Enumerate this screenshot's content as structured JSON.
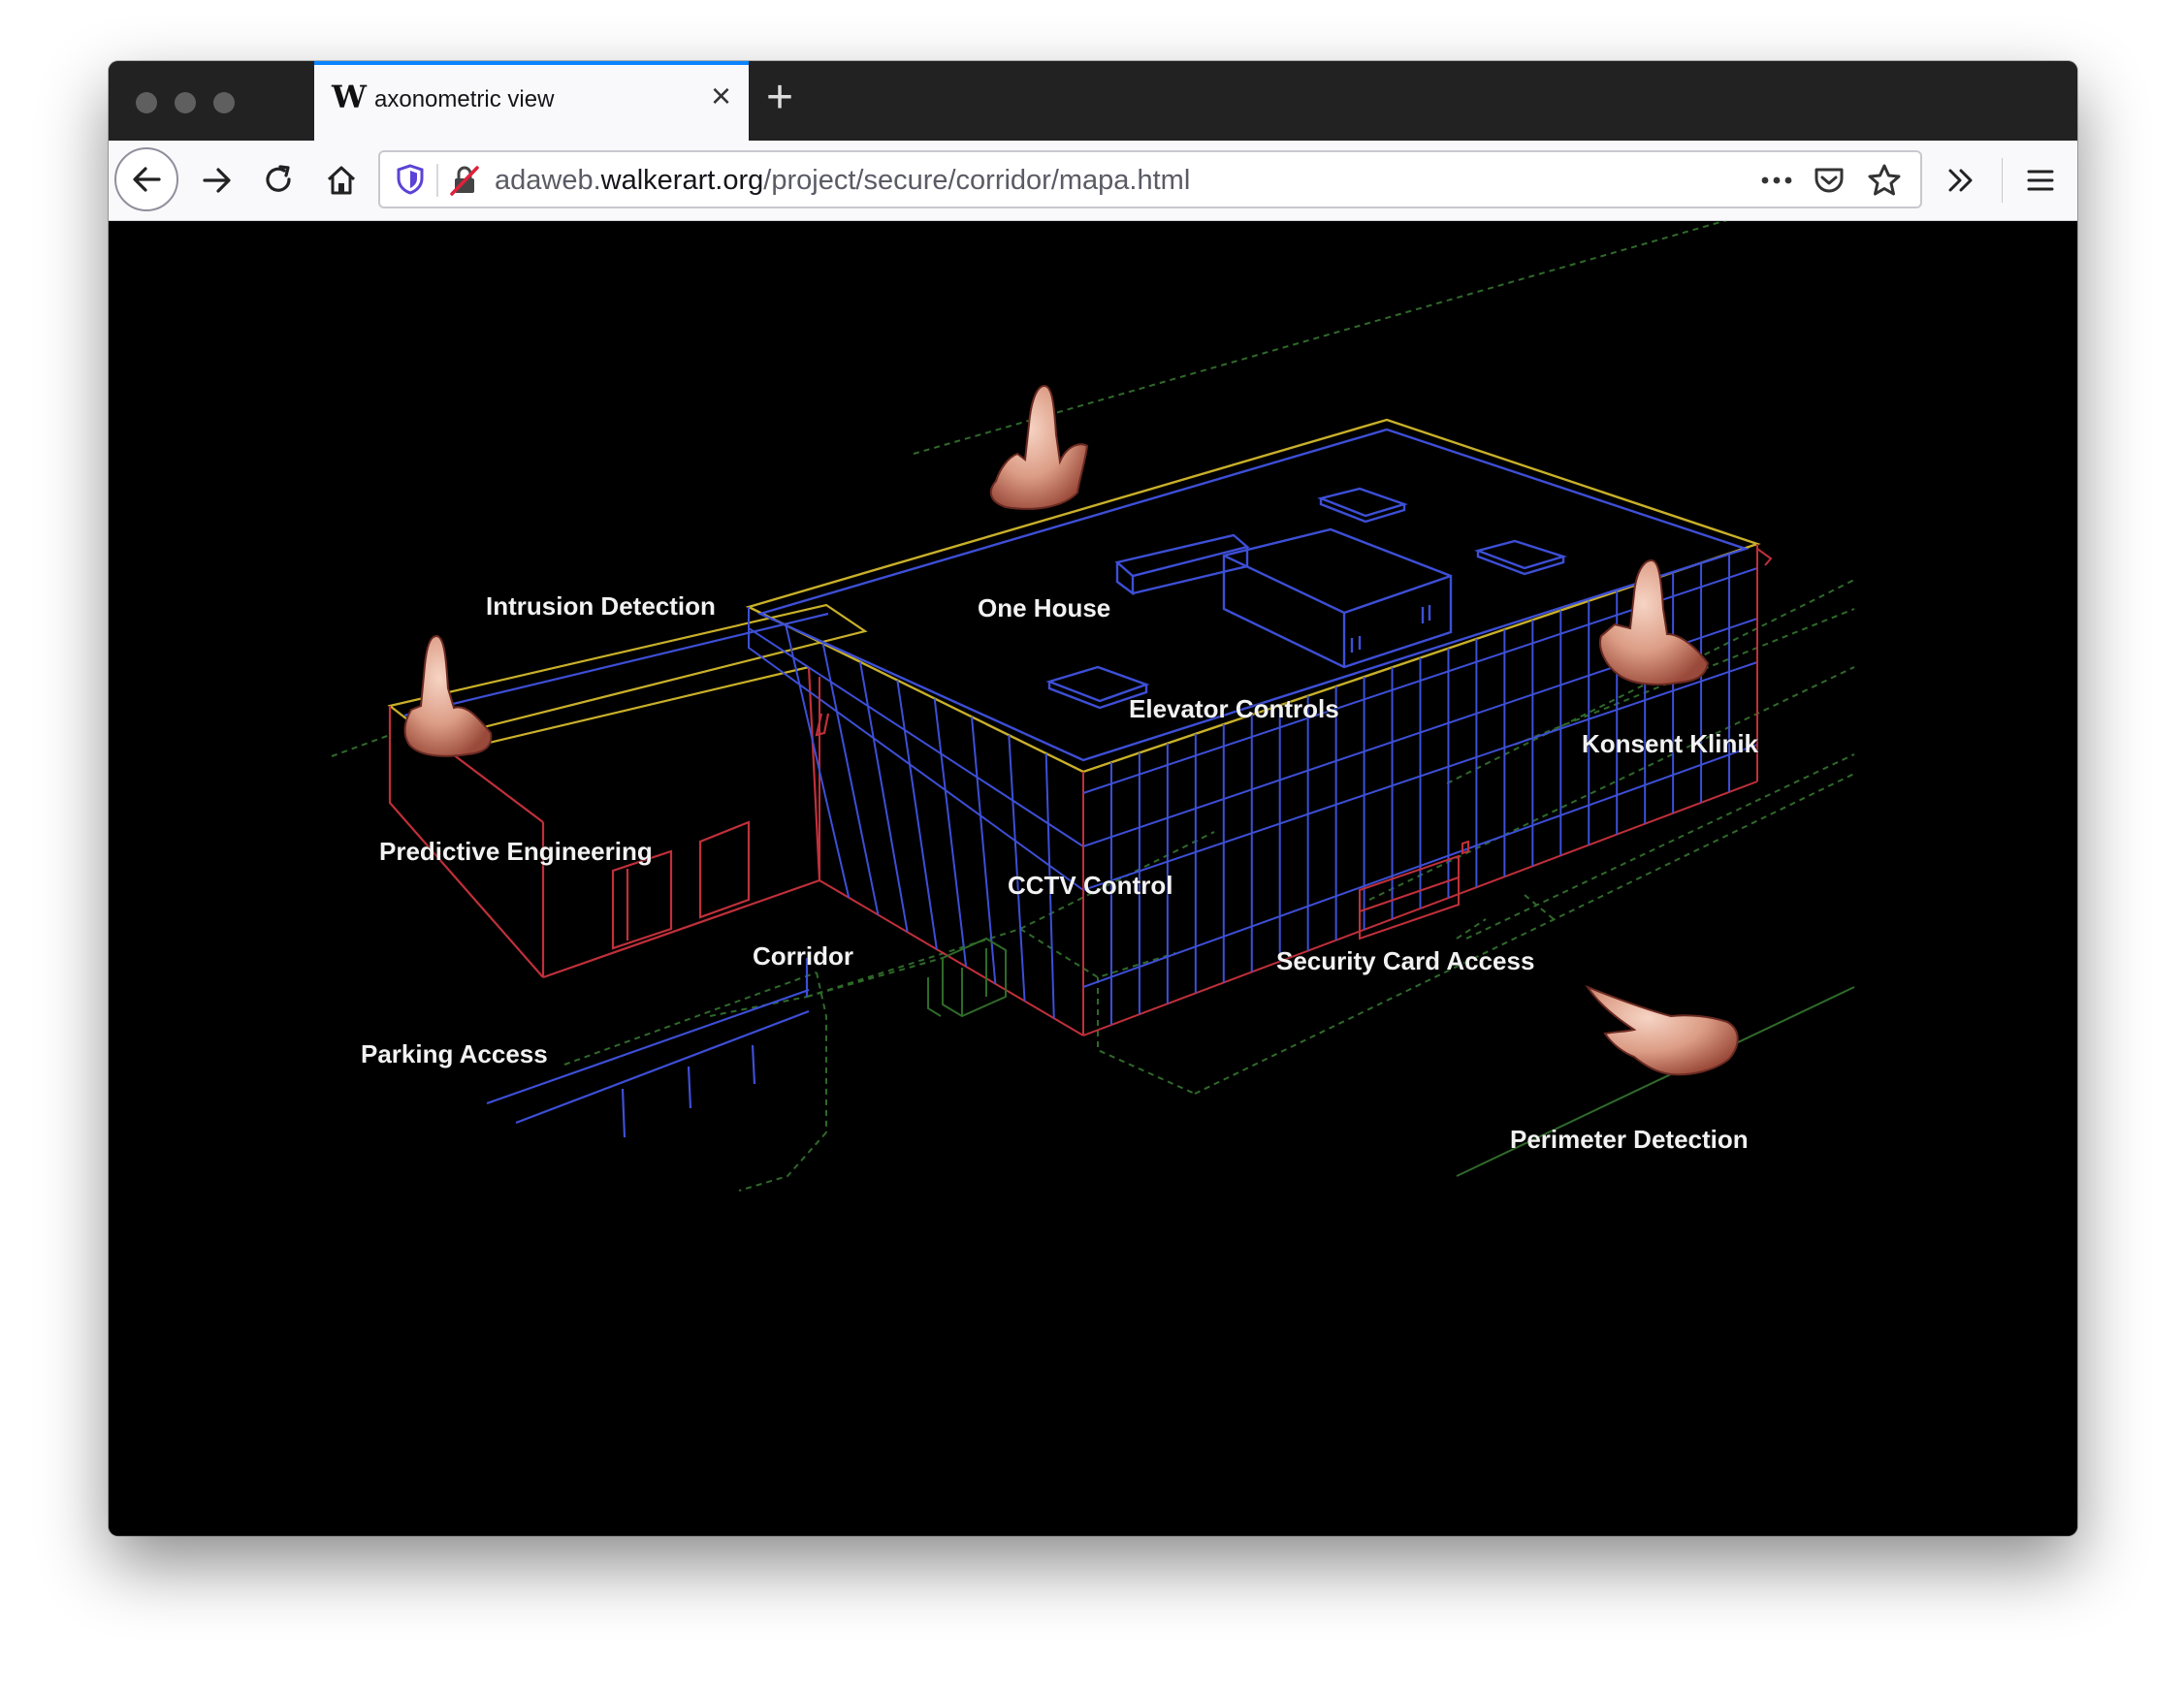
{
  "tab": {
    "favicon": "W",
    "title": "axonometric view"
  },
  "toolbar": {
    "url_prefix": "adaweb.",
    "url_domain": "walkerart.org",
    "url_path": "/project/secure/corridor/mapa.html",
    "icons": [
      "back-icon",
      "forward-icon",
      "reload-icon",
      "home-icon",
      "shield-icon",
      "insecure-lock-icon",
      "more-icon",
      "pocket-icon",
      "star-icon",
      "overflow-icon",
      "menu-icon"
    ]
  },
  "map": {
    "labels": {
      "intrusion_detection": "Intrusion Detection",
      "one_house": "One House",
      "elevator_controls": "Elevator Controls",
      "konsent_klinik": "Konsent Klinik",
      "predictive_engineering": "Predictive Engineering",
      "cctv_control": "CCTV Control",
      "corridor": "Corridor",
      "security_card_access": "Security Card Access",
      "parking_access": "Parking Access",
      "perimeter_detection": "Perimeter Detection"
    },
    "colors": {
      "roof_outline": "#c9b02a",
      "facade_grid": "#3d4fd6",
      "wall_edges": "#c0303a",
      "ground_lines": "#2f6a2a",
      "hand_skin": "#e0a08a"
    }
  }
}
